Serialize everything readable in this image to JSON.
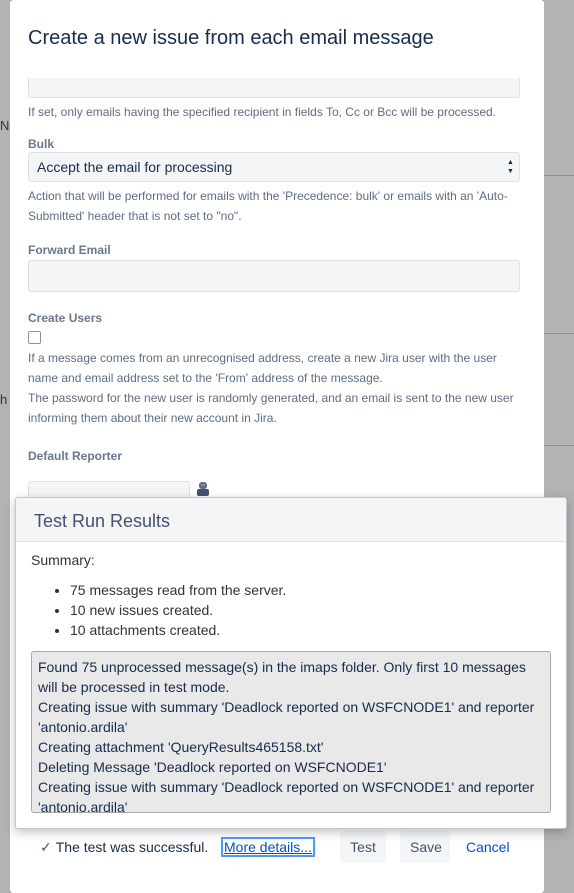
{
  "dialog": {
    "title": "Create a new issue from each email message"
  },
  "form": {
    "recipient_help": "If set, only emails having the specified recipient in fields To, Cc or Bcc will be processed.",
    "bulk": {
      "label": "Bulk",
      "selected": "Accept the email for processing",
      "help": "Action that will be performed for emails with the 'Precedence: bulk' or emails with an 'Auto-Submitted' header that is not set to \"no\"."
    },
    "forward_email": {
      "label": "Forward Email",
      "value": ""
    },
    "create_users": {
      "label": "Create Users",
      "checked": false,
      "help_1": "If a message comes from an unrecognised address, create a new Jira user with the user name and email address set to the 'From' address of the message.",
      "help_2": "The password for the new user is randomly generated, and an email is sent to the new user informing them about their new account in Jira."
    },
    "default_reporter": {
      "label": "Default Reporter"
    }
  },
  "results": {
    "title": "Test Run Results",
    "summary_label": "Summary:",
    "summary_items": [
      "75 messages read from the server.",
      "10 new issues created.",
      "10 attachments created."
    ],
    "log_lines": [
      "Found 75 unprocessed message(s) in the imaps folder. Only first 10 messages will be processed in test mode.",
      "Creating issue with summary 'Deadlock reported on WSFCNODE1' and reporter 'antonio.ardila'",
      "Creating attachment 'QueryResults465158.txt'",
      "Deleting Message 'Deadlock reported on WSFCNODE1'",
      "Creating issue with summary 'Deadlock reported on WSFCNODE1' and reporter 'antonio.ardila'"
    ]
  },
  "footer": {
    "success_text": "The test was successful.",
    "details_link": "More details...",
    "test_label": "Test",
    "save_label": "Save",
    "cancel_label": "Cancel"
  },
  "icons": {
    "success": "check-icon",
    "reporter": "user-picker-icon",
    "select": "select-arrows-icon"
  },
  "colors": {
    "link": "#0052cc",
    "focus_ring": "#4c9aff",
    "overlay": "#9a9a9a"
  }
}
